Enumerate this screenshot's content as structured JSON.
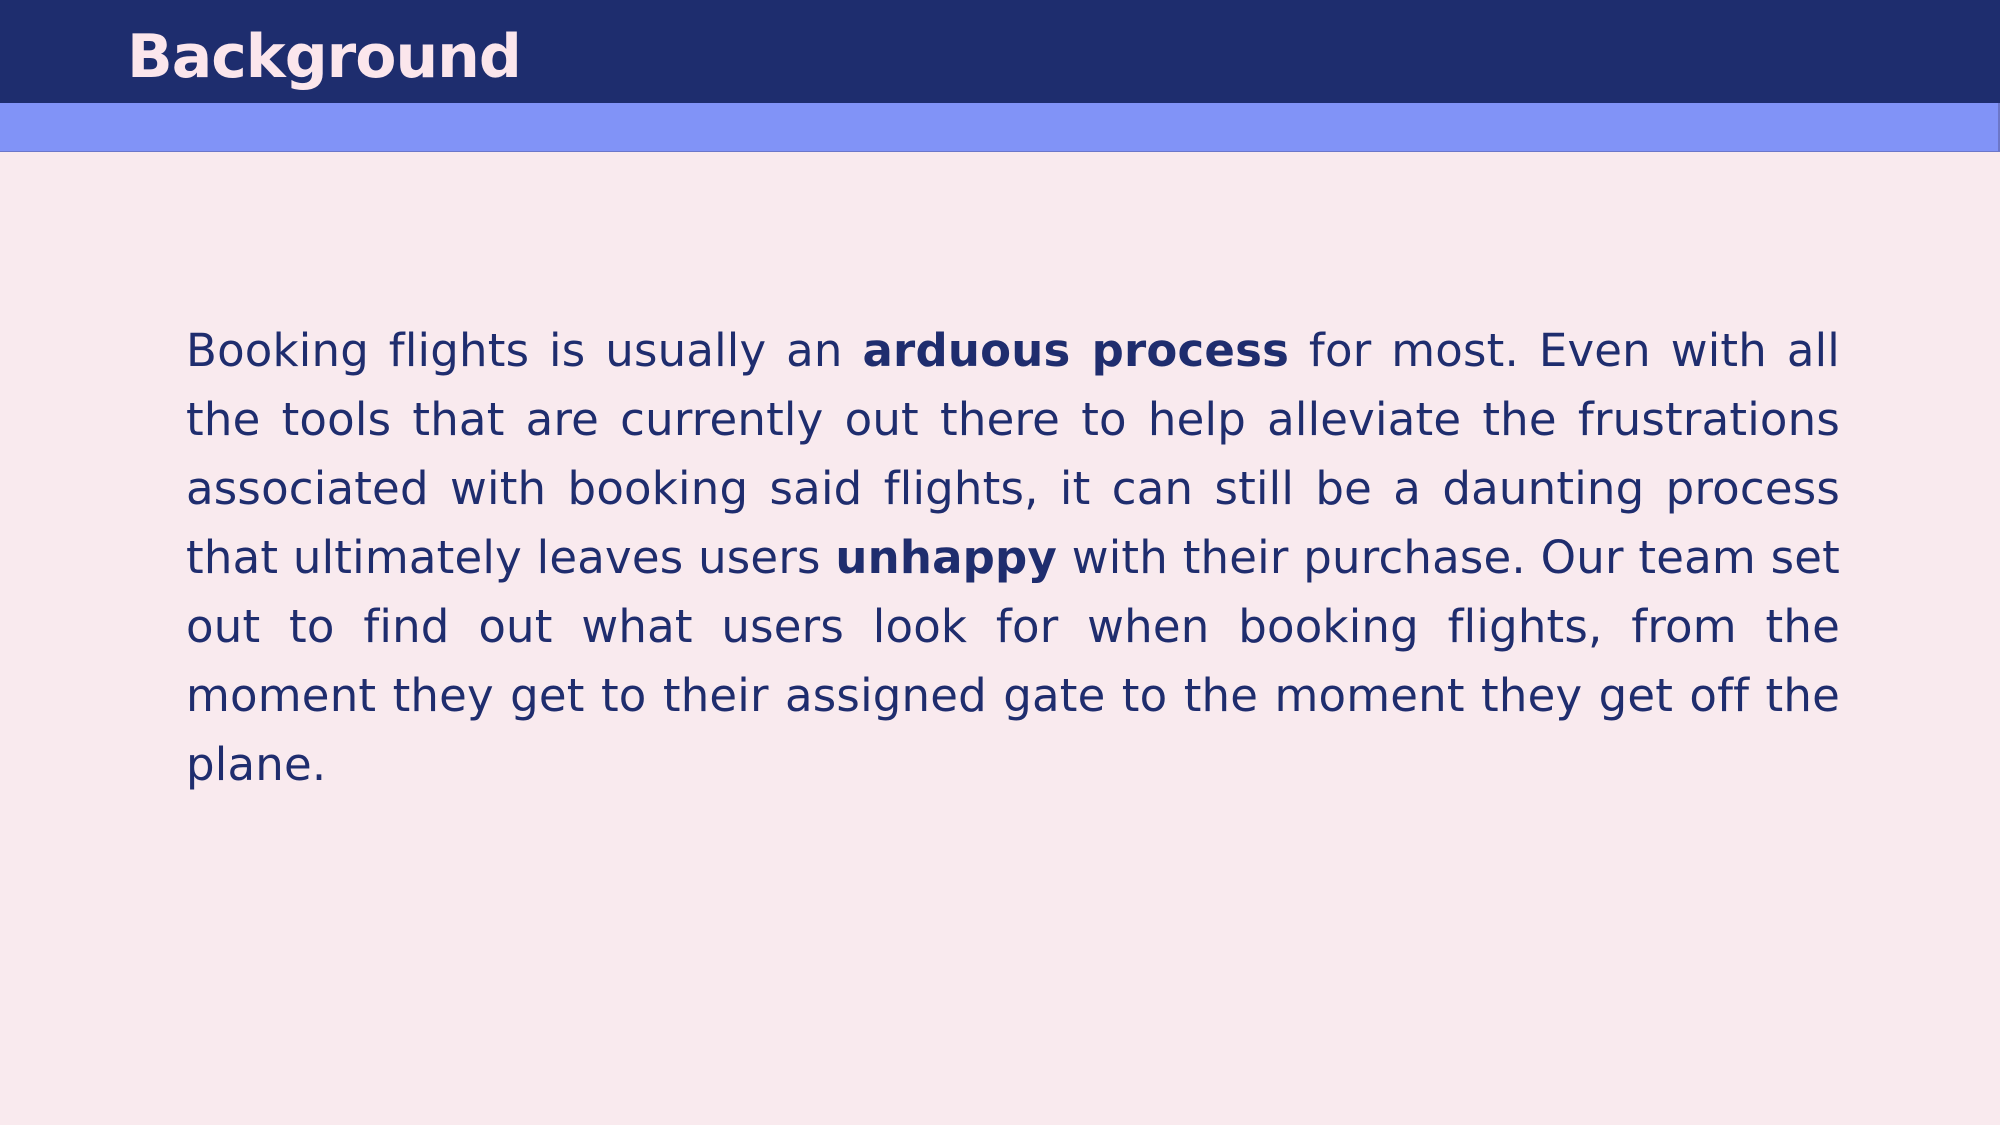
{
  "slide": {
    "title": "Background",
    "paragraph": {
      "part1": "Booking flights is usually an ",
      "emphasis1": "arduous process",
      "part2": " for most. Even with all the tools that are currently out there to help alleviate the frustrations associated with booking said flights, it can still be a daunting process that ultimately leaves users ",
      "emphasis2": "unhappy",
      "part3": " with their purchase. Our team set out to find out what users look for when booking flights, from the moment they get to their assigned gate to the moment they get off the plane."
    }
  },
  "colors": {
    "background": "#f9eaee",
    "title_bar": "#1e2d6e",
    "accent_bar": "#8193f7",
    "title_text": "#fbe6ec",
    "body_text": "#1f2d6e"
  }
}
